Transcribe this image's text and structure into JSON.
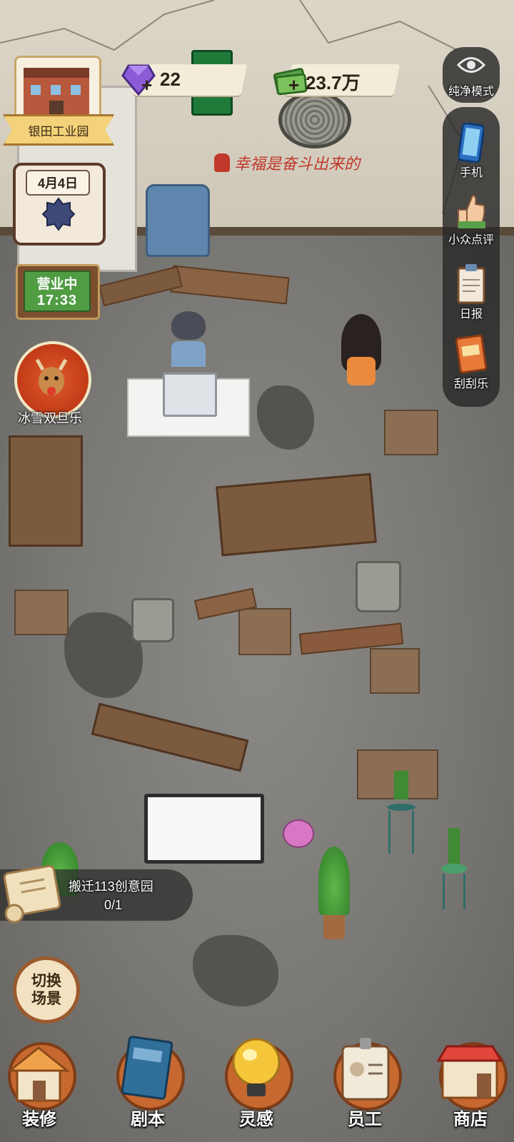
{
  "currency": {
    "gems": "22",
    "money": "23.7万",
    "plus_symbol": "+"
  },
  "wall_slogan": "幸福是奋斗出来的",
  "left_hud": {
    "location": "银田工业园",
    "date": "4月4日",
    "status": "营业中",
    "time": "17:33",
    "event": "冰雪双旦乐"
  },
  "right_panel": {
    "pure_mode": "纯净模式",
    "phone": "手机",
    "review": "小众点评",
    "daily": "日报",
    "scratch": "刮刮乐"
  },
  "quest": {
    "title": "搬迁113创意园",
    "progress": "0/1"
  },
  "switch_scene": "切换场景",
  "bottom_nav": [
    {
      "label": "装修",
      "icon": "house-icon"
    },
    {
      "label": "剧本",
      "icon": "script-book-icon"
    },
    {
      "label": "灵感",
      "icon": "lightbulb-icon"
    },
    {
      "label": "员工",
      "icon": "badge-icon"
    },
    {
      "label": "商店",
      "icon": "shop-icon"
    }
  ],
  "colors": {
    "accent": "#c6682f",
    "open_green": "#4f9c43",
    "gem_purple": "#8a5cd6",
    "money_green": "#5aa04a"
  }
}
